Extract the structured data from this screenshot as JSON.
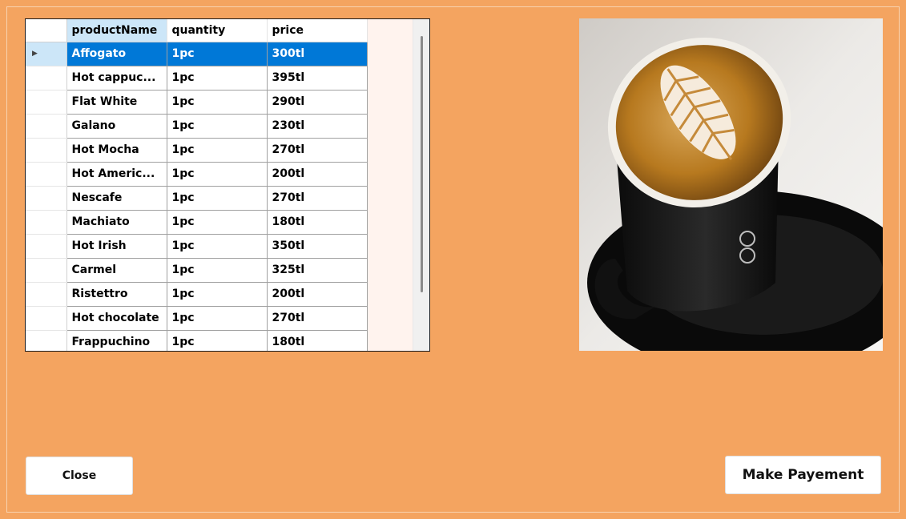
{
  "grid": {
    "columns": [
      "productName",
      "quantity",
      "price"
    ],
    "selected_row_index": 0,
    "rows": [
      {
        "productName": "Affogato",
        "quantity": "1pc",
        "price": "300tl"
      },
      {
        "productName": "Hot cappuc...",
        "quantity": "1pc",
        "price": "395tl"
      },
      {
        "productName": "Flat White",
        "quantity": "1pc",
        "price": "290tl"
      },
      {
        "productName": "Galano",
        "quantity": "1pc",
        "price": "230tl"
      },
      {
        "productName": "Hot Mocha",
        "quantity": "1pc",
        "price": "270tl"
      },
      {
        "productName": "Hot Americ...",
        "quantity": "1pc",
        "price": "200tl"
      },
      {
        "productName": "Nescafe",
        "quantity": "1pc",
        "price": "270tl"
      },
      {
        "productName": "Machiato",
        "quantity": "1pc",
        "price": "180tl"
      },
      {
        "productName": "Hot Irish",
        "quantity": "1pc",
        "price": "350tl"
      },
      {
        "productName": "Carmel",
        "quantity": "1pc",
        "price": "325tl"
      },
      {
        "productName": "Ristettro",
        "quantity": "1pc",
        "price": "200tl"
      },
      {
        "productName": "Hot chocolate",
        "quantity": "1pc",
        "price": "270tl"
      },
      {
        "productName": "Frappuchino",
        "quantity": "1pc",
        "price": "180tl"
      }
    ],
    "row_indicator_icon": "triangle-right-icon"
  },
  "image": {
    "subject": "latte-art-coffee-cup"
  },
  "buttons": {
    "close_label": "Close",
    "payment_label": "Make Payement"
  },
  "colors": {
    "background": "#F4A460",
    "selection": "#0078D7",
    "header_selected": "#CCE6F8"
  }
}
